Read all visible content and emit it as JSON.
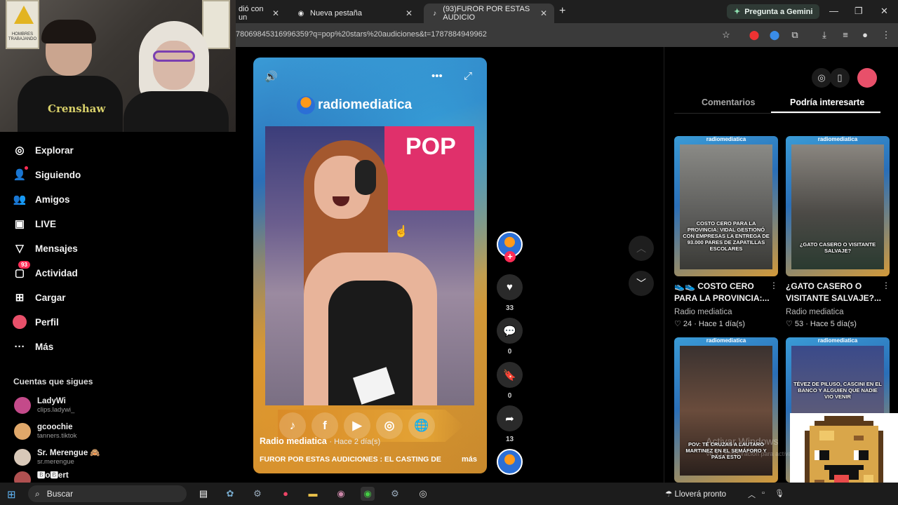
{
  "browser": {
    "tabs": [
      {
        "title": "dió con un",
        "active": false
      },
      {
        "title": "Nueva pestaña",
        "active": false
      },
      {
        "title": "(93)FUROR POR ESTAS AUDICIO",
        "active": true
      }
    ],
    "gemini_label": "Pregunta a Gemini",
    "url": "7806984531699​6359?q=pop%20stars%20audiciones&t=1787884949962"
  },
  "webcam": {
    "shirt_text": "Crenshaw",
    "sign_text": "HOMBRES TRABAJANDO"
  },
  "sidebar": {
    "items": [
      {
        "label": "Explorar",
        "icon": "compass-icon"
      },
      {
        "label": "Siguiendo",
        "icon": "user-follow-icon"
      },
      {
        "label": "Amigos",
        "icon": "friends-icon"
      },
      {
        "label": "LIVE",
        "icon": "live-icon"
      },
      {
        "label": "Mensajes",
        "icon": "message-icon"
      },
      {
        "label": "Actividad",
        "icon": "activity-icon",
        "badge": "93"
      },
      {
        "label": "Cargar",
        "icon": "upload-icon"
      },
      {
        "label": "Perfil",
        "icon": "profile-avatar"
      },
      {
        "label": "Más",
        "icon": "more-icon"
      }
    ],
    "following_header": "Cuentas que sigues",
    "following": [
      {
        "name": "LadyWi",
        "handle": "clips.ladywi_",
        "color": "#c44a8a"
      },
      {
        "name": "gcoochie",
        "handle": "tanners.tiktok",
        "color": "#e0a86a"
      },
      {
        "name": "Sr. Merengue 🙈",
        "handle": "sr.merengue",
        "color": "#d8c8b8"
      },
      {
        "name": "🅱o🅱ert",
        "handle": "",
        "color": "#b05050"
      }
    ]
  },
  "video": {
    "brand": "radiomediatica",
    "pop_sign": "POP",
    "socials": [
      "♪",
      "f",
      "▶",
      "◎",
      "🌐"
    ],
    "author": "Radio mediatica",
    "time": "· Hace 2 día(s)",
    "description": "FUROR POR ESTAS AUDICIONES : EL CASTING DE",
    "more": "más"
  },
  "actions": {
    "likes": "33",
    "comments": "0",
    "saves": "0",
    "shares": "13"
  },
  "rightpanel": {
    "tabs": [
      "Comentarios",
      "Podría interesarte"
    ],
    "cards": [
      {
        "brand": "radiomediatica",
        "caption": "COSTO CERO PARA LA PROVINCIA: VIDAL GESTIONÓ CON EMPRESAS LA ENTREGA DE 93.000 PARES DE ZAPATILLAS ESCOLARES",
        "title": "👟👟 COSTO CERO PARA LA PROVINCIA:...",
        "author": "Radio mediatica",
        "meta": "♡ 24 · Hace 1 día(s)"
      },
      {
        "brand": "radiomediatica",
        "caption": "¿GATO CASERO O VISITANTE SALVAJE?",
        "title": "¿GATO CASERO O VISITANTE SALVAJE?...",
        "author": "Radio mediatica",
        "meta": "♡ 53 · Hace 5 día(s)"
      },
      {
        "brand": "radiomediatica",
        "caption": "POV: TE CRUZAS A LAUTARO MARTINEZ EN EL SEMÁFORO Y PASA ESTO",
        "title": "",
        "author": "",
        "meta": ""
      },
      {
        "brand": "radiomediatica",
        "caption": "TÉVEZ DE PILUSO, CASCINI EN EL BANCO Y ALGUIEN QUE NADIE VIO VENIR",
        "title": "",
        "author": "",
        "meta": ""
      }
    ]
  },
  "watermark": {
    "line1": "Activar Windows",
    "line2": "Ve a Configuración para activar Windows."
  },
  "taskbar": {
    "search": "Buscar",
    "weather": "Lloverá pronto"
  }
}
